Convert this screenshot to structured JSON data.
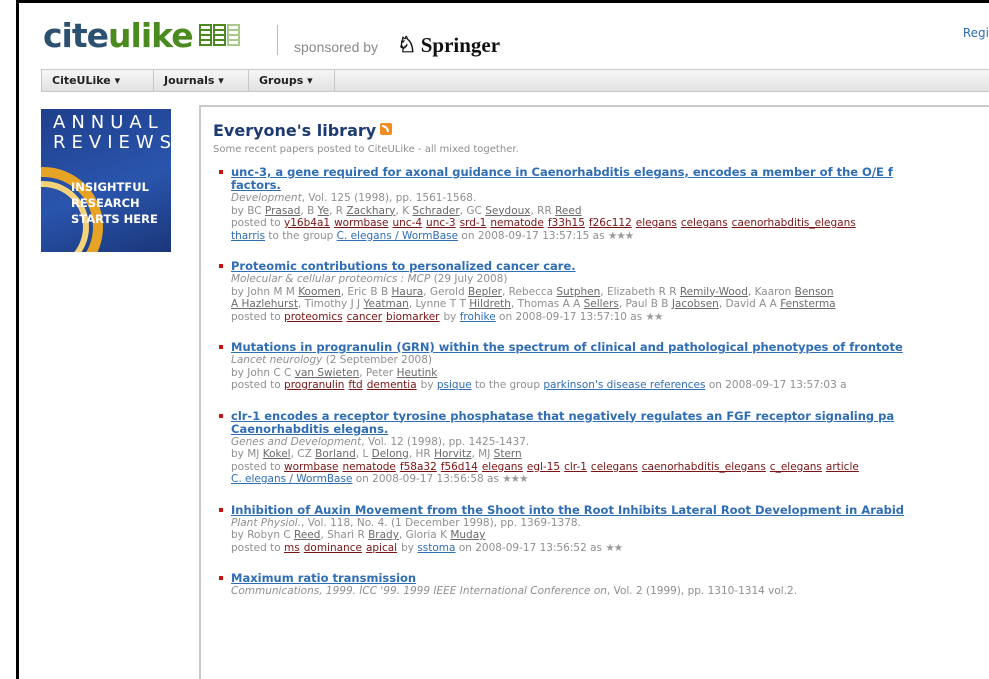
{
  "header": {
    "logo_cite": "cite",
    "logo_ulike": "ulike",
    "sponsored": "sponsored by",
    "springer": "Springer",
    "register_link": "Regi"
  },
  "nav": [
    {
      "label": "CiteULike ▾"
    },
    {
      "label": "Journals ▾"
    },
    {
      "label": "Groups ▾"
    }
  ],
  "ad": {
    "title": "ANNUAL REVIEWS",
    "title_line1": "ANNUAL",
    "title_line2": "REVIEWS",
    "tag_line1": "INSIGHTFUL",
    "tag_line2": "RESEARCH",
    "tag_line3": "STARTS HERE"
  },
  "library": {
    "title": "Everyone's library",
    "subtitle": "Some recent papers posted to CiteULike - all mixed together."
  },
  "papers": [
    {
      "title_l1": "unc-3, a gene required for axonal guidance in Caenorhabditis elegans, encodes a member of the O/E f",
      "title_l2": "factors.",
      "pub_italic": "Development",
      "pub_rest": ", Vol. 125 (1998), pp. 1561-1568.",
      "authors_prefix": "by ",
      "authors": [
        {
          "init": "BC ",
          "name": "Prasad"
        },
        {
          "init": ", B ",
          "name": "Ye"
        },
        {
          "init": ", R ",
          "name": "Zackhary"
        },
        {
          "init": ", K ",
          "name": "Schrader"
        },
        {
          "init": ", GC ",
          "name": "Seydoux"
        },
        {
          "init": ", RR ",
          "name": "Reed"
        }
      ],
      "posted_to": "posted to ",
      "tags": [
        "y16b4a1",
        "wormbase",
        "unc-4",
        "unc-3",
        "srd-1",
        "nematode",
        "f33h15",
        "f26c112",
        "elegans",
        "celegans",
        "caenorhabditis_elegans"
      ],
      "line2_user": "tharris",
      "line2_mid": " to the group ",
      "line2_group": "C. elegans / WormBase",
      "line2_tail": " on 2008-09-17 13:57:15 as ",
      "stars": "★★★"
    },
    {
      "title_l1": "Proteomic contributions to personalized cancer care.",
      "pub_italic": "Molecular & cellular proteomics : MCP",
      "pub_rest": " (29 July 2008)",
      "authors_line1": [
        {
          "init": "by John M M ",
          "name": "Koomen"
        },
        {
          "init": ", Eric B B ",
          "name": "Haura"
        },
        {
          "init": ", Gerold ",
          "name": "Bepler"
        },
        {
          "init": ", Rebecca ",
          "name": "Sutphen"
        },
        {
          "init": ", Elizabeth R R ",
          "name": "Remily-Wood"
        },
        {
          "init": ", Kaaron ",
          "name": "Benson"
        }
      ],
      "authors_line2": [
        {
          "init": "",
          "name": "A Hazlehurst"
        },
        {
          "init": ", Timothy J J ",
          "name": "Yeatman"
        },
        {
          "init": ", Lynne T T ",
          "name": "Hildreth"
        },
        {
          "init": ", Thomas A A ",
          "name": "Sellers"
        },
        {
          "init": ", Paul B B ",
          "name": "Jacobsen"
        },
        {
          "init": ", David A A ",
          "name": "Fensterma"
        }
      ],
      "posted_to": "posted to ",
      "tags": [
        "proteomics",
        "cancer",
        "biomarker"
      ],
      "by": "by ",
      "user": "frohike",
      "tail": " on 2008-09-17 13:57:10 as ",
      "stars": "★★"
    },
    {
      "title_l1": "Mutations in progranulin (GRN) within the spectrum of clinical and pathological phenotypes of frontote",
      "pub_italic": "Lancet neurology",
      "pub_rest": " (2 September 2008)",
      "authors": [
        {
          "init": "by John C C ",
          "name": "van Swieten"
        },
        {
          "init": ", Peter ",
          "name": "Heutink"
        }
      ],
      "posted_to": "posted to ",
      "tags": [
        "progranulin",
        "ftd",
        "dementia"
      ],
      "by": "by ",
      "user": "psique",
      "mid": " to the group ",
      "group": "parkinson's disease references",
      "tail": " on 2008-09-17 13:57:03 a"
    },
    {
      "title_l1": "clr-1 encodes a receptor tyrosine phosphatase that negatively regulates an FGF receptor signaling pa",
      "title_l2": "Caenorhabditis elegans.",
      "pub_italic": "Genes and Development",
      "pub_rest": ", Vol. 12 (1998), pp. 1425-1437.",
      "authors": [
        {
          "init": "by MJ ",
          "name": "Kokel"
        },
        {
          "init": ", CZ ",
          "name": "Borland"
        },
        {
          "init": ", L ",
          "name": "Delong"
        },
        {
          "init": ", HR ",
          "name": "Horvitz"
        },
        {
          "init": ", MJ ",
          "name": "Stern"
        }
      ],
      "posted_to": "posted to ",
      "tags": [
        "wormbase",
        "nematode",
        "f58a32",
        "f56d14",
        "elegans",
        "egl-15",
        "clr-1",
        "celegans",
        "caenorhabditis_elegans",
        "c_elegans",
        "article"
      ],
      "line2_group": "C. elegans / WormBase",
      "line2_tail": " on 2008-09-17 13:56:58 as ",
      "stars": "★★★"
    },
    {
      "title_l1": "Inhibition of Auxin Movement from the Shoot into the Root Inhibits Lateral Root Development in Arabid",
      "pub_italic": "Plant Physiol.",
      "pub_rest": ", Vol. 118, No. 4. (1 December 1998), pp. 1369-1378.",
      "authors": [
        {
          "init": "by Robyn C ",
          "name": "Reed"
        },
        {
          "init": ", Shari R ",
          "name": "Brady"
        },
        {
          "init": ", Gloria K ",
          "name": "Muday"
        }
      ],
      "posted_to": "posted to ",
      "tags": [
        "ms",
        "dominance",
        "apical"
      ],
      "by": "by ",
      "user": "sstoma",
      "tail": " on 2008-09-17 13:56:52 as ",
      "stars": "★★"
    },
    {
      "title_l1": "Maximum ratio transmission",
      "pub_italic": "Communications, 1999. ICC '99. 1999 IEEE International Conference on",
      "pub_rest": ", Vol. 2 (1999), pp. 1310-1314 vol.2."
    }
  ]
}
